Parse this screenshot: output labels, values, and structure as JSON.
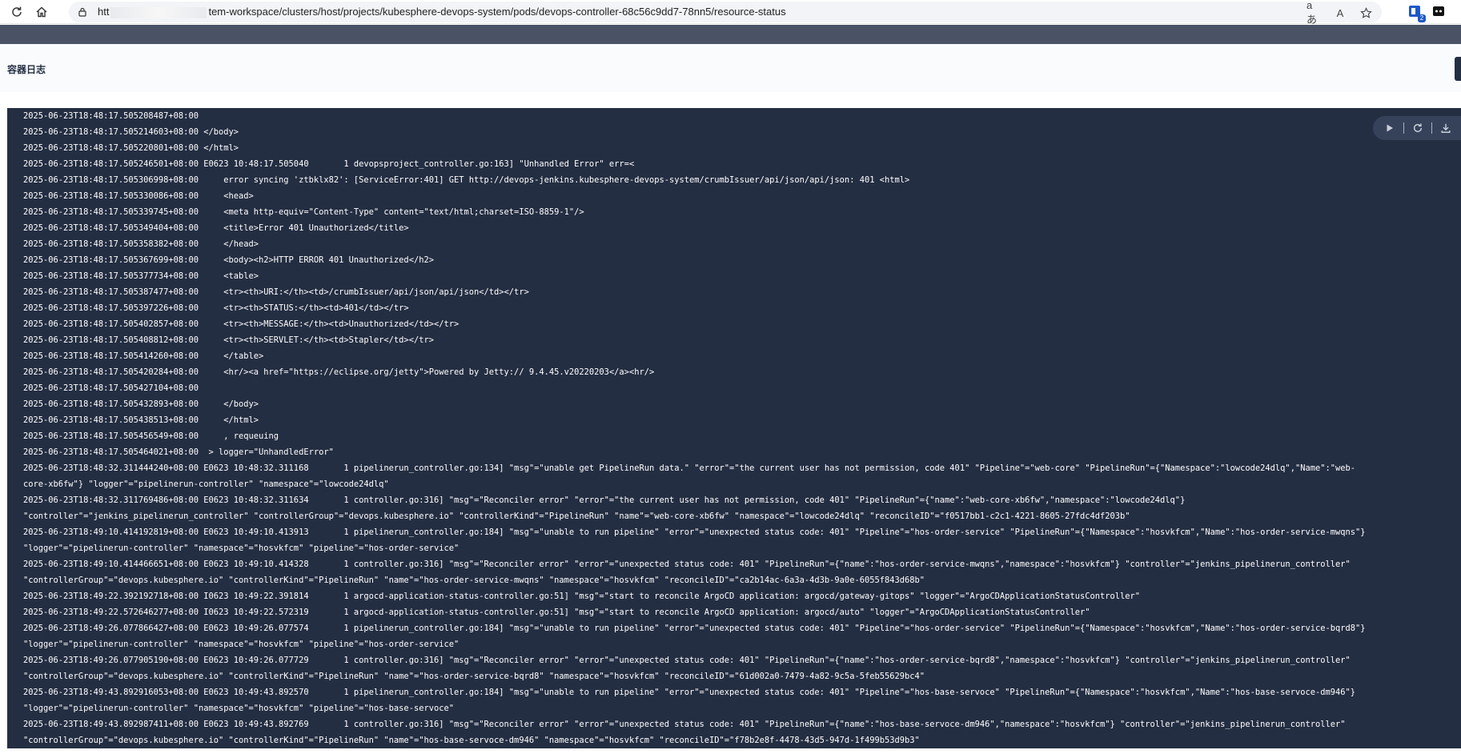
{
  "browser": {
    "url_prefix": "htt",
    "url_suffix": "tem-workspace/clusters/host/projects/kubesphere-devops-system/pods/devops-controller-68c56c9dd7-78nn5/resource-status",
    "read_aloud_label": "aあ",
    "immersive_label": "A",
    "ext_badge_count": "2"
  },
  "section": {
    "title": "容器日志"
  },
  "log": {
    "lines": [
      "2025-06-23T18:48:17.505208487+08:00",
      "2025-06-23T18:48:17.505214603+08:00 </body>",
      "2025-06-23T18:48:17.505220801+08:00 </html>",
      "2025-06-23T18:48:17.505246501+08:00 E0623 10:48:17.505040       1 devopsproject_controller.go:163] \"Unhandled Error\" err=<",
      "2025-06-23T18:48:17.505306998+08:00     error syncing 'ztbklx82': [ServiceError:401] GET http://devops-jenkins.kubesphere-devops-system/crumbIssuer/api/json/api/json: 401 <html>",
      "2025-06-23T18:48:17.505330086+08:00     <head>",
      "2025-06-23T18:48:17.505339745+08:00     <meta http-equiv=\"Content-Type\" content=\"text/html;charset=ISO-8859-1\"/>",
      "2025-06-23T18:48:17.505349404+08:00     <title>Error 401 Unauthorized</title>",
      "2025-06-23T18:48:17.505358382+08:00     </head>",
      "2025-06-23T18:48:17.505367699+08:00     <body><h2>HTTP ERROR 401 Unauthorized</h2>",
      "2025-06-23T18:48:17.505377734+08:00     <table>",
      "2025-06-23T18:48:17.505387477+08:00     <tr><th>URI:</th><td>/crumbIssuer/api/json/api/json</td></tr>",
      "2025-06-23T18:48:17.505397226+08:00     <tr><th>STATUS:</th><td>401</td></tr>",
      "2025-06-23T18:48:17.505402857+08:00     <tr><th>MESSAGE:</th><td>Unauthorized</td></tr>",
      "2025-06-23T18:48:17.505408812+08:00     <tr><th>SERVLET:</th><td>Stapler</td></tr>",
      "2025-06-23T18:48:17.505414260+08:00     </table>",
      "2025-06-23T18:48:17.505420284+08:00     <hr/><a href=\"https://eclipse.org/jetty\">Powered by Jetty:// 9.4.45.v20220203</a><hr/>",
      "2025-06-23T18:48:17.505427104+08:00",
      "2025-06-23T18:48:17.505432893+08:00     </body>",
      "2025-06-23T18:48:17.505438513+08:00     </html>",
      "2025-06-23T18:48:17.505456549+08:00     , requeuing",
      "2025-06-23T18:48:17.505464021+08:00  > logger=\"UnhandledError\"",
      "2025-06-23T18:48:32.311444240+08:00 E0623 10:48:32.311168       1 pipelinerun_controller.go:134] \"msg\"=\"unable get PipelineRun data.\" \"error\"=\"the current user has not permission, code 401\" \"Pipeline\"=\"web-core\" \"PipelineRun\"={\"Namespace\":\"lowcode24dlq\",\"Name\":\"web-",
      "core-xb6fw\"} \"logger\"=\"pipelinerun-controller\" \"namespace\"=\"lowcode24dlq\"",
      "2025-06-23T18:48:32.311769486+08:00 E0623 10:48:32.311634       1 controller.go:316] \"msg\"=\"Reconciler error\" \"error\"=\"the current user has not permission, code 401\" \"PipelineRun\"={\"name\":\"web-core-xb6fw\",\"namespace\":\"lowcode24dlq\"}",
      "\"controller\"=\"jenkins_pipelinerun_controller\" \"controllerGroup\"=\"devops.kubesphere.io\" \"controllerKind\"=\"PipelineRun\" \"name\"=\"web-core-xb6fw\" \"namespace\"=\"lowcode24dlq\" \"reconcileID\"=\"f0517bb1-c2c1-4221-8605-27fdc4df203b\"",
      "2025-06-23T18:49:10.414192819+08:00 E0623 10:49:10.413913       1 pipelinerun_controller.go:184] \"msg\"=\"unable to run pipeline\" \"error\"=\"unexpected status code: 401\" \"Pipeline\"=\"hos-order-service\" \"PipelineRun\"={\"Namespace\":\"hosvkfcm\",\"Name\":\"hos-order-service-mwqns\"}",
      "\"logger\"=\"pipelinerun-controller\" \"namespace\"=\"hosvkfcm\" \"pipeline\"=\"hos-order-service\"",
      "2025-06-23T18:49:10.414466651+08:00 E0623 10:49:10.414328       1 controller.go:316] \"msg\"=\"Reconciler error\" \"error\"=\"unexpected status code: 401\" \"PipelineRun\"={\"name\":\"hos-order-service-mwqns\",\"namespace\":\"hosvkfcm\"} \"controller\"=\"jenkins_pipelinerun_controller\"",
      "\"controllerGroup\"=\"devops.kubesphere.io\" \"controllerKind\"=\"PipelineRun\" \"name\"=\"hos-order-service-mwqns\" \"namespace\"=\"hosvkfcm\" \"reconcileID\"=\"ca2b14ac-6a3a-4d3b-9a0e-6055f843d68b\"",
      "2025-06-23T18:49:22.392192718+08:00 I0623 10:49:22.391814       1 argocd-application-status-controller.go:51] \"msg\"=\"start to reconcile ArgoCD application: argocd/gateway-gitops\" \"logger\"=\"ArgoCDApplicationStatusController\"",
      "2025-06-23T18:49:22.572646277+08:00 I0623 10:49:22.572319       1 argocd-application-status-controller.go:51] \"msg\"=\"start to reconcile ArgoCD application: argocd/auto\" \"logger\"=\"ArgoCDApplicationStatusController\"",
      "2025-06-23T18:49:26.077866427+08:00 E0623 10:49:26.077574       1 pipelinerun_controller.go:184] \"msg\"=\"unable to run pipeline\" \"error\"=\"unexpected status code: 401\" \"Pipeline\"=\"hos-order-service\" \"PipelineRun\"={\"Namespace\":\"hosvkfcm\",\"Name\":\"hos-order-service-bqrd8\"}",
      "\"logger\"=\"pipelinerun-controller\" \"namespace\"=\"hosvkfcm\" \"pipeline\"=\"hos-order-service\"",
      "2025-06-23T18:49:26.077905190+08:00 E0623 10:49:26.077729       1 controller.go:316] \"msg\"=\"Reconciler error\" \"error\"=\"unexpected status code: 401\" \"PipelineRun\"={\"name\":\"hos-order-service-bqrd8\",\"namespace\":\"hosvkfcm\"} \"controller\"=\"jenkins_pipelinerun_controller\"",
      "\"controllerGroup\"=\"devops.kubesphere.io\" \"controllerKind\"=\"PipelineRun\" \"name\"=\"hos-order-service-bqrd8\" \"namespace\"=\"hosvkfcm\" \"reconcileID\"=\"61d002a0-7479-4a82-9c5a-5feb55629bc4\"",
      "2025-06-23T18:49:43.892916053+08:00 E0623 10:49:43.892570       1 pipelinerun_controller.go:184] \"msg\"=\"unable to run pipeline\" \"error\"=\"unexpected status code: 401\" \"Pipeline\"=\"hos-base-servoce\" \"PipelineRun\"={\"Namespace\":\"hosvkfcm\",\"Name\":\"hos-base-servoce-dm946\"}",
      "\"logger\"=\"pipelinerun-controller\" \"namespace\"=\"hosvkfcm\" \"pipeline\"=\"hos-base-servoce\"",
      "2025-06-23T18:49:43.892987411+08:00 E0623 10:49:43.892769       1 controller.go:316] \"msg\"=\"Reconciler error\" \"error\"=\"unexpected status code: 401\" \"PipelineRun\"={\"name\":\"hos-base-servoce-dm946\",\"namespace\":\"hosvkfcm\"} \"controller\"=\"jenkins_pipelinerun_controller\"",
      "\"controllerGroup\"=\"devops.kubesphere.io\" \"controllerKind\"=\"PipelineRun\" \"name\"=\"hos-base-servoce-dm946\" \"namespace\"=\"hosvkfcm\" \"reconcileID\"=\"f78b2e8f-4478-43d5-947d-1f499b53d9b3\""
    ]
  },
  "icons": {
    "reload": "reload-icon",
    "home": "home-icon",
    "lock": "lock-icon",
    "read_aloud": "read-aloud-icon",
    "immersive_reader": "immersive-reader-icon",
    "favorite": "star-icon",
    "play": "play-icon",
    "refresh": "refresh-icon",
    "download": "download-icon"
  },
  "colors": {
    "log_bg": "#242e42",
    "log_text": "#ffffff",
    "app_strip": "#4a5366"
  }
}
